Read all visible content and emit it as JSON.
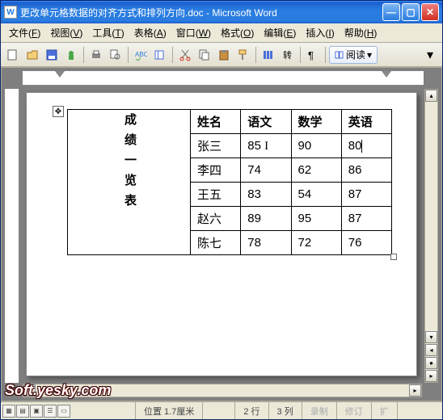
{
  "title": "更改单元格数据的对齐方式和排列方向.doc - Microsoft Word",
  "menus": [
    {
      "label": "文件",
      "hot": "F"
    },
    {
      "label": "视图",
      "hot": "V"
    },
    {
      "label": "工具",
      "hot": "T"
    },
    {
      "label": "表格",
      "hot": "A"
    },
    {
      "label": "窗口",
      "hot": "W"
    },
    {
      "label": "格式",
      "hot": "O"
    },
    {
      "label": "编辑",
      "hot": "E"
    },
    {
      "label": "插入",
      "hot": "I"
    },
    {
      "label": "帮助",
      "hot": "H"
    }
  ],
  "reading_label": "阅读",
  "side_title": "成绩一览表",
  "table": {
    "headers": [
      "姓名",
      "语文",
      "数学",
      "英语"
    ],
    "rows": [
      [
        "张三",
        "85",
        "90",
        "80"
      ],
      [
        "李四",
        "74",
        "62",
        "86"
      ],
      [
        "王五",
        "83",
        "54",
        "87"
      ],
      [
        "赵六",
        "89",
        "95",
        "87"
      ],
      [
        "陈七",
        "78",
        "72",
        "76"
      ]
    ]
  },
  "status": {
    "pos": "位置 1.7厘米",
    "line": "2 行",
    "col": "3 列",
    "rec": "录制",
    "rev": "修订",
    "ext": "扩"
  },
  "watermark": "Soft.yesky.com",
  "chart_data": {
    "type": "table",
    "title": "成绩一览表",
    "columns": [
      "姓名",
      "语文",
      "数学",
      "英语"
    ],
    "rows": [
      {
        "姓名": "张三",
        "语文": 85,
        "数学": 90,
        "英语": 80
      },
      {
        "姓名": "李四",
        "语文": 74,
        "数学": 62,
        "英语": 86
      },
      {
        "姓名": "王五",
        "语文": 83,
        "数学": 54,
        "英语": 87
      },
      {
        "姓名": "赵六",
        "语文": 89,
        "数学": 95,
        "英语": 87
      },
      {
        "姓名": "陈七",
        "语文": 78,
        "数学": 72,
        "英语": 76
      }
    ]
  }
}
